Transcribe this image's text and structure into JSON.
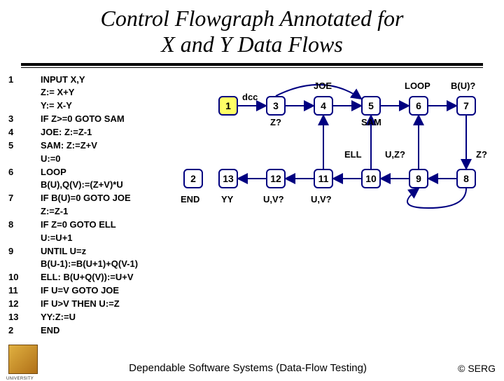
{
  "title_l1": "Control Flowgraph Annotated for",
  "title_l2": "X and Y Data Flows",
  "code": [
    {
      "n": "1",
      "t": "INPUT X,Y"
    },
    {
      "n": "",
      "t": "Z:= X+Y"
    },
    {
      "n": "",
      "t": "Y:= X-Y"
    },
    {
      "n": "3",
      "t": "IF Z>=0 GOTO SAM"
    },
    {
      "n": "4",
      "t": "JOE: Z:=Z-1"
    },
    {
      "n": "5",
      "t": "SAM: Z:=Z+V"
    },
    {
      "n": "",
      "t": "U:=0"
    },
    {
      "n": "6",
      "t": "LOOP"
    },
    {
      "n": "",
      "t": "B(U),Q(V):=(Z+V)*U"
    },
    {
      "n": "7",
      "t": "IF B(U)=0 GOTO JOE"
    },
    {
      "n": "",
      "t": "Z:=Z-1"
    },
    {
      "n": "8",
      "t": "IF Z=0 GOTO ELL"
    },
    {
      "n": "",
      "t": "U:=U+1"
    },
    {
      "n": "9",
      "t": "UNTIL U=z"
    },
    {
      "n": "",
      "t": "B(U-1):=B(U+1)+Q(V-1)"
    },
    {
      "n": "10",
      "t": "ELL: B(U+Q(V)):=U+V"
    },
    {
      "n": "11",
      "t": "IF U=V GOTO JOE"
    },
    {
      "n": "12",
      "t": "IF U>V THEN U:=Z"
    },
    {
      "n": "13",
      "t": "YY:Z:=U"
    },
    {
      "n": "2",
      "t": "END"
    }
  ],
  "graph": {
    "nodes": {
      "n1": "1",
      "n3": "3",
      "n4": "4",
      "n5": "5",
      "n6": "6",
      "n7": "7",
      "n2": "2",
      "n13": "13",
      "n12": "12",
      "n11": "11",
      "n10": "10",
      "n9": "9",
      "n8": "8"
    },
    "labels": {
      "dcc": "dcc",
      "joe": "JOE",
      "loop": "LOOP",
      "bu": "B(U)?",
      "zq": "Z?",
      "sam": "SAM",
      "ell": "ELL",
      "uz": "U,Z?",
      "zq2": "Z?",
      "end": "END",
      "yy": "YY",
      "uv1": "U,V?",
      "uv2": "U,V?"
    }
  },
  "footer_center": "Dependable Software Systems (Data-Flow Testing)",
  "footer_right": "© SERG"
}
